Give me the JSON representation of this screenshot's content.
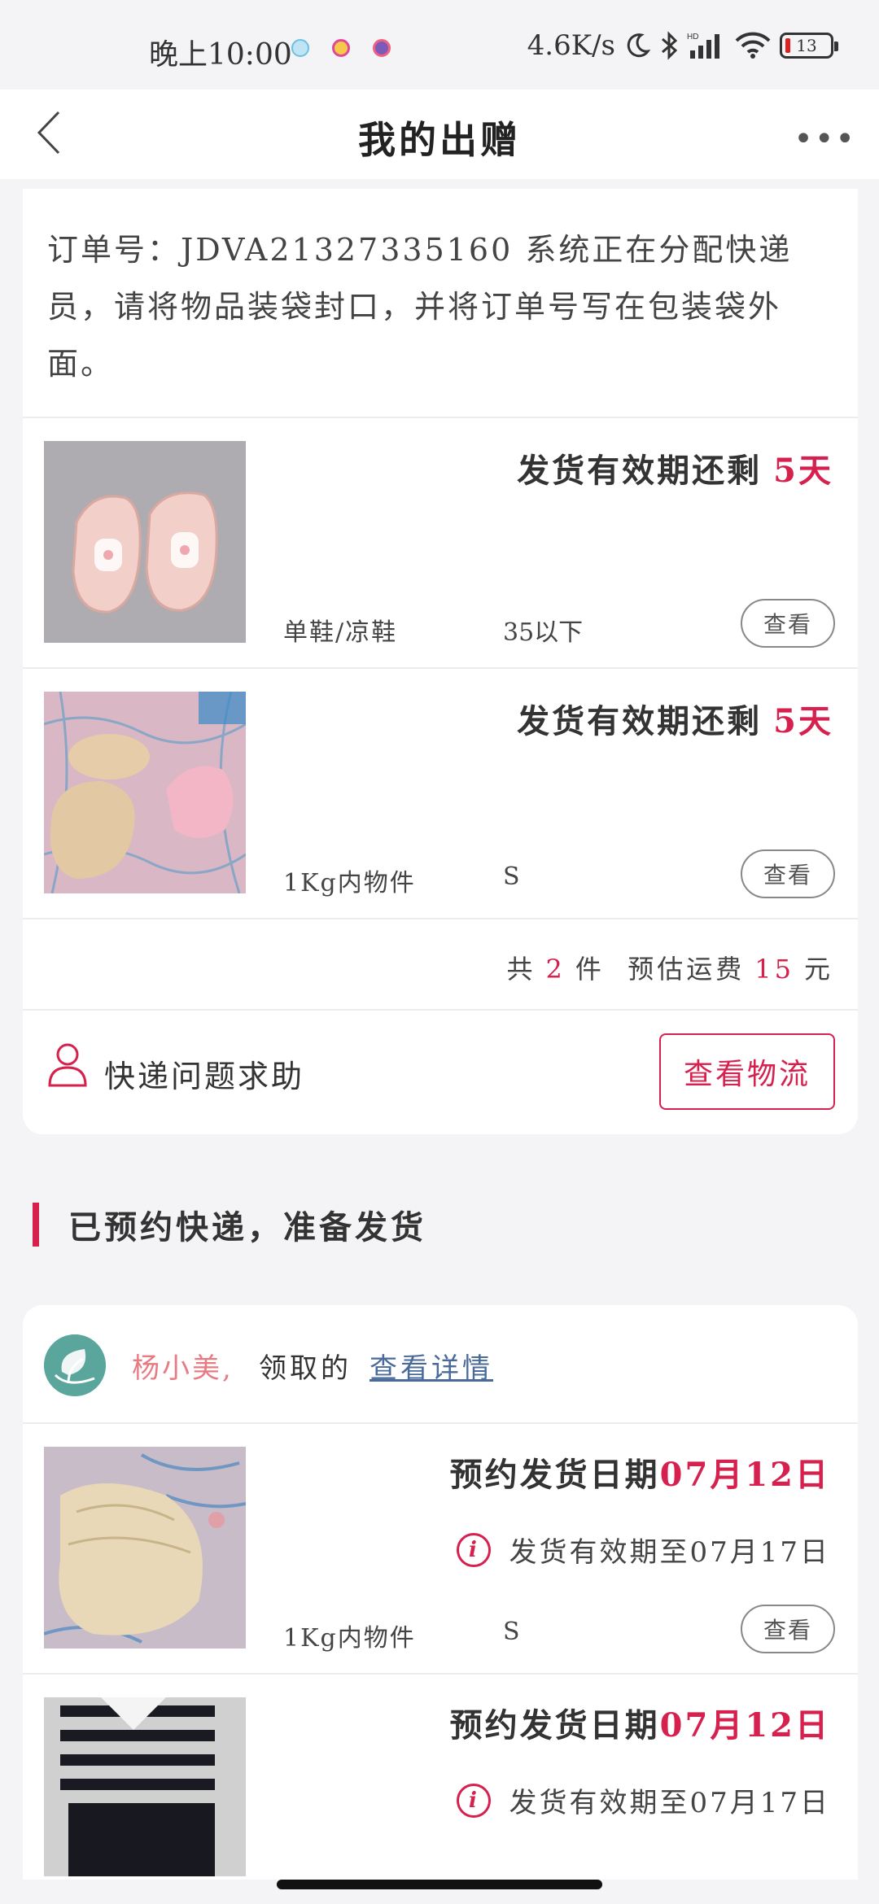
{
  "status_bar": {
    "time": "晚上10:00",
    "network_speed": "4.6K/s",
    "battery": "13"
  },
  "nav": {
    "title": "我的出赠",
    "more_label": "•••"
  },
  "order": {
    "note": "订单号：JDVA21327335160  系统正在分配快递员，请将物品装袋封口，并将订单号写在包装袋外面。",
    "items": [
      {
        "deadline_label": "发货有效期还剩",
        "deadline_value": "5天",
        "category": "单鞋/凉鞋",
        "size": "35以下",
        "view_label": "查看",
        "image": "pink-sandals"
      },
      {
        "deadline_label": "发货有效期还剩",
        "deadline_value": "5天",
        "category": "1Kg内物件",
        "size": "S",
        "view_label": "查看",
        "image": "baby-clothes"
      }
    ],
    "summary": {
      "prefix": "共",
      "count": "2",
      "count_unit": "件",
      "fee_label": "预估运费",
      "fee": "15",
      "fee_unit": "元"
    },
    "help_label": "快递问题求助",
    "logistics_label": "查看物流"
  },
  "section2": {
    "title": "已预约快递，准备发货",
    "receiver_name": "杨小美,",
    "receiver_text": "领取的",
    "receiver_link": "查看详情",
    "items": [
      {
        "ship_label": "预约发货日期",
        "ship_date": "07月12日",
        "valid_text": "发货有效期至07月17日",
        "category": "1Kg内物件",
        "size": "S",
        "view_label": "查看",
        "image": "beige-knit"
      },
      {
        "ship_label": "预约发货日期",
        "ship_date": "07月12日",
        "valid_text": "发货有效期至07月17日",
        "image": "striped-shirt"
      }
    ]
  },
  "colors": {
    "accent": "#d6204e",
    "receiver_name": "#e87a82",
    "link": "#4a6a9a",
    "background": "#f4f4f6"
  }
}
